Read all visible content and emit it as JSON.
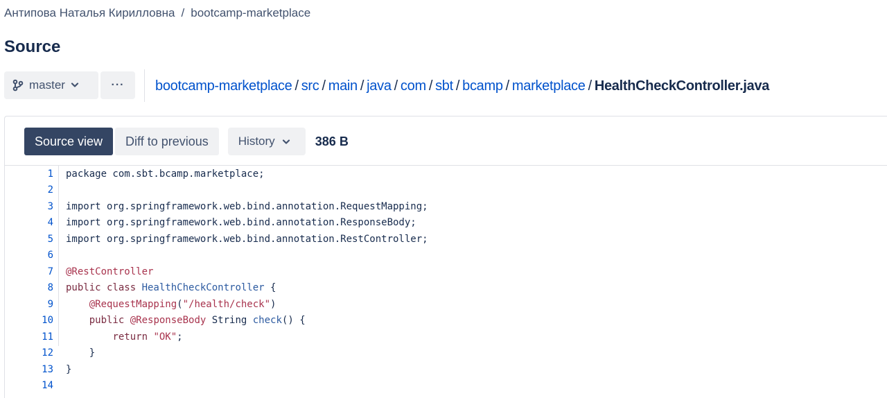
{
  "breadcrumb": {
    "owner": "Антипова Наталья Кирилловна",
    "separator": "/",
    "repo": "bootcamp-marketplace"
  },
  "page_title": "Source",
  "branch": {
    "name": "master",
    "icon": "branch-icon",
    "caret": "chevron-down-icon"
  },
  "more_button": {
    "label": "···",
    "icon": "more-icon"
  },
  "path": {
    "segments": [
      "bootcamp-marketplace",
      "src",
      "main",
      "java",
      "com",
      "sbt",
      "bcamp",
      "marketplace"
    ],
    "separator": "/",
    "file": "HealthCheckController.java"
  },
  "tabs": {
    "source_view": "Source view",
    "diff_to_previous": "Diff to previous",
    "history": "History"
  },
  "file_size": "386 B",
  "colors": {
    "link": "#0052cc",
    "active_tab": "#344563",
    "keyword": "#7a2b41",
    "annotation": "#a8334d",
    "type": "#2c5aa0"
  },
  "code": {
    "lines": [
      [
        {
          "t": "package com.sbt.bcamp.marketplace;",
          "c": "plain"
        }
      ],
      [],
      [
        {
          "t": "import org.springframework.web.bind.annotation.RequestMapping;",
          "c": "plain"
        }
      ],
      [
        {
          "t": "import org.springframework.web.bind.annotation.ResponseBody;",
          "c": "plain"
        }
      ],
      [
        {
          "t": "import org.springframework.web.bind.annotation.RestController;",
          "c": "plain"
        }
      ],
      [],
      [
        {
          "t": "@RestController",
          "c": "an"
        }
      ],
      [
        {
          "t": "public class ",
          "c": "kw"
        },
        {
          "t": "HealthCheckController",
          "c": "ty"
        },
        {
          "t": " {",
          "c": "plain"
        }
      ],
      [
        {
          "t": "    ",
          "c": "plain"
        },
        {
          "t": "@RequestMapping",
          "c": "an"
        },
        {
          "t": "(",
          "c": "plain"
        },
        {
          "t": "\"/health/check\"",
          "c": "st"
        },
        {
          "t": ")",
          "c": "plain"
        }
      ],
      [
        {
          "t": "    ",
          "c": "plain"
        },
        {
          "t": "public ",
          "c": "kw"
        },
        {
          "t": "@ResponseBody",
          "c": "an"
        },
        {
          "t": " String ",
          "c": "plain"
        },
        {
          "t": "check",
          "c": "ty"
        },
        {
          "t": "() {",
          "c": "plain"
        }
      ],
      [
        {
          "t": "        ",
          "c": "plain"
        },
        {
          "t": "return ",
          "c": "kw"
        },
        {
          "t": "\"OK\"",
          "c": "st"
        },
        {
          "t": ";",
          "c": "plain"
        }
      ],
      [
        {
          "t": "    }",
          "c": "plain"
        }
      ],
      [
        {
          "t": "}",
          "c": "plain"
        }
      ],
      []
    ]
  }
}
